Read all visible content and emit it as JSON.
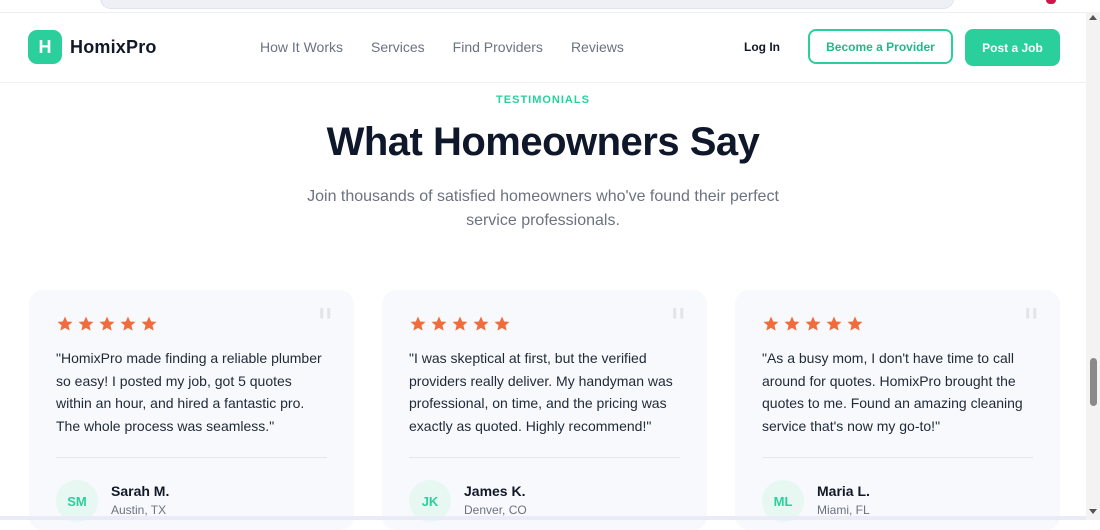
{
  "brand": {
    "logo_letter": "H",
    "name": "HomixPro",
    "accent": "#2bcf9c"
  },
  "nav": {
    "links": [
      "How It Works",
      "Services",
      "Find Providers",
      "Reviews"
    ],
    "login": "Log In",
    "become_provider": "Become a Provider",
    "post_job": "Post a Job"
  },
  "section": {
    "eyebrow": "TESTIMONIALS",
    "title": "What Homeowners Say",
    "subtitle": "Join thousands of satisfied homeowners who've found their perfect service professionals."
  },
  "testimonials": [
    {
      "rating": 5,
      "quote_icon": "quote-icon",
      "text": "\"HomixPro made finding a reliable plumber so easy! I posted my job, got 5 quotes within an hour, and hired a fantastic pro. The whole process was seamless.\"",
      "initials": "SM",
      "name": "Sarah M.",
      "location": "Austin, TX"
    },
    {
      "rating": 5,
      "quote_icon": "quote-icon",
      "text": "\"I was skeptical at first, but the verified providers really deliver. My handyman was professional, on time, and the pricing was exactly as quoted. Highly recommend!\"",
      "initials": "JK",
      "name": "James K.",
      "location": "Denver, CO"
    },
    {
      "rating": 5,
      "quote_icon": "quote-icon",
      "text": "\"As a busy mom, I don't have time to call around for quotes. HomixPro brought the quotes to me. Found an amazing cleaning service that's now my go-to!\"",
      "initials": "ML",
      "name": "Maria L.",
      "location": "Miami, FL"
    }
  ],
  "colors": {
    "star": "#f26b3a",
    "title": "#0f172a",
    "muted": "#6b7280"
  }
}
